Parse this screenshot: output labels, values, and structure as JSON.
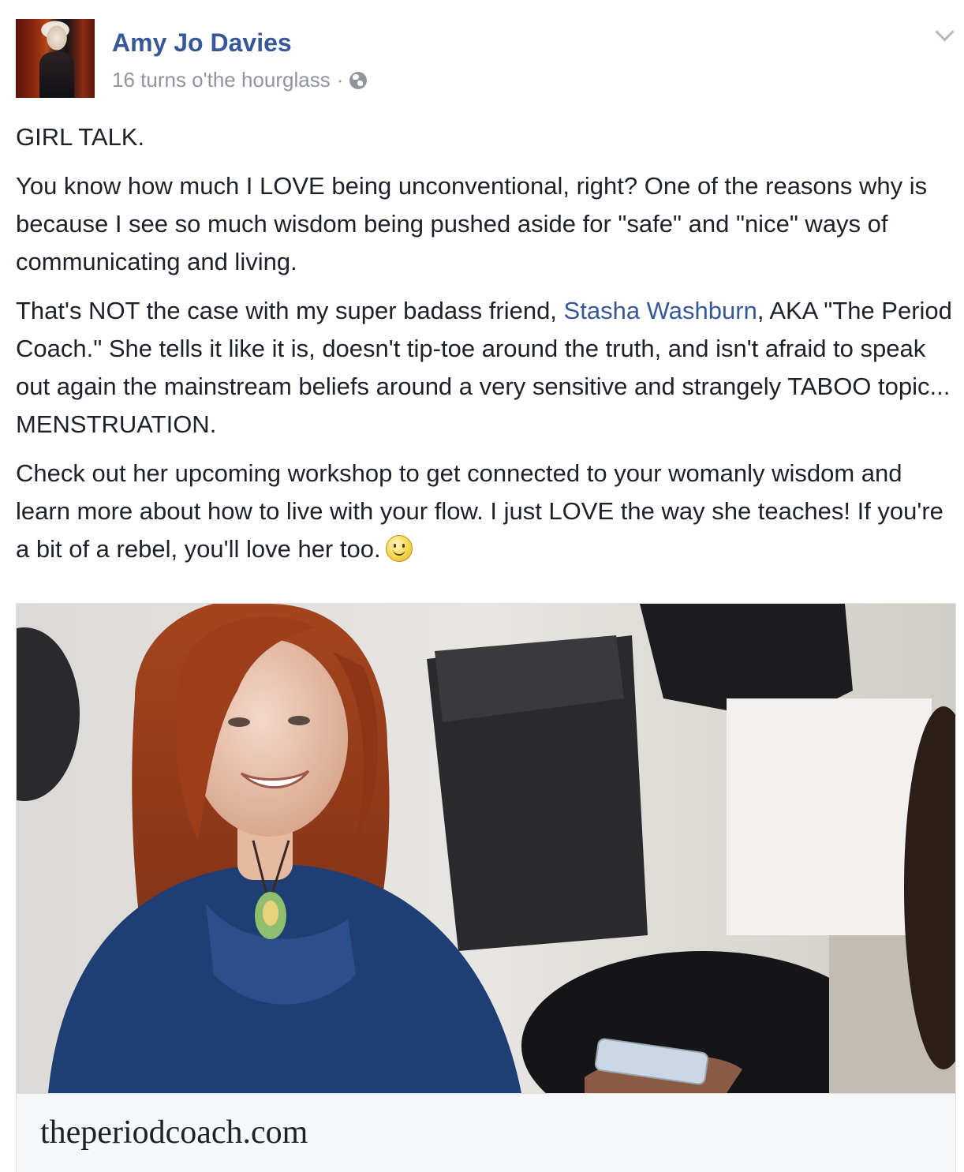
{
  "post": {
    "author": "Amy Jo Davies",
    "timestamp": "16 turns o'the hourglass",
    "meta_separator": "·",
    "privacy_icon": "globe-icon",
    "options_icon": "chevron-down-icon",
    "paragraphs": {
      "p1": "GIRL TALK.",
      "p2": "You know how much I LOVE being unconventional, right? One of the reasons why is because I see so much wisdom being pushed aside for \"safe\" and \"nice\" ways of communicating and living.",
      "p3_before": "That's NOT the case with my super badass friend, ",
      "p3_mention": "Stasha Washburn",
      "p3_after": ", AKA \"The Period Coach.\" She tells it like it is, doesn't tip-toe around the truth, and isn't afraid to speak out again the mainstream beliefs around a very sensitive and strangely TABOO topic... MENSTRUATION.",
      "p4": "Check out her upcoming workshop to get connected to your womanly wisdom and learn more about how to live with your flow. I just LOVE the way she teaches! If you're a bit of a rebel, you'll love her too."
    },
    "emoji_icon": "smiley-icon"
  },
  "link_preview": {
    "domain": "theperiodcoach.com"
  },
  "colors": {
    "link_blue": "#365899",
    "text": "#1d2129",
    "meta_gray": "#90949c"
  }
}
